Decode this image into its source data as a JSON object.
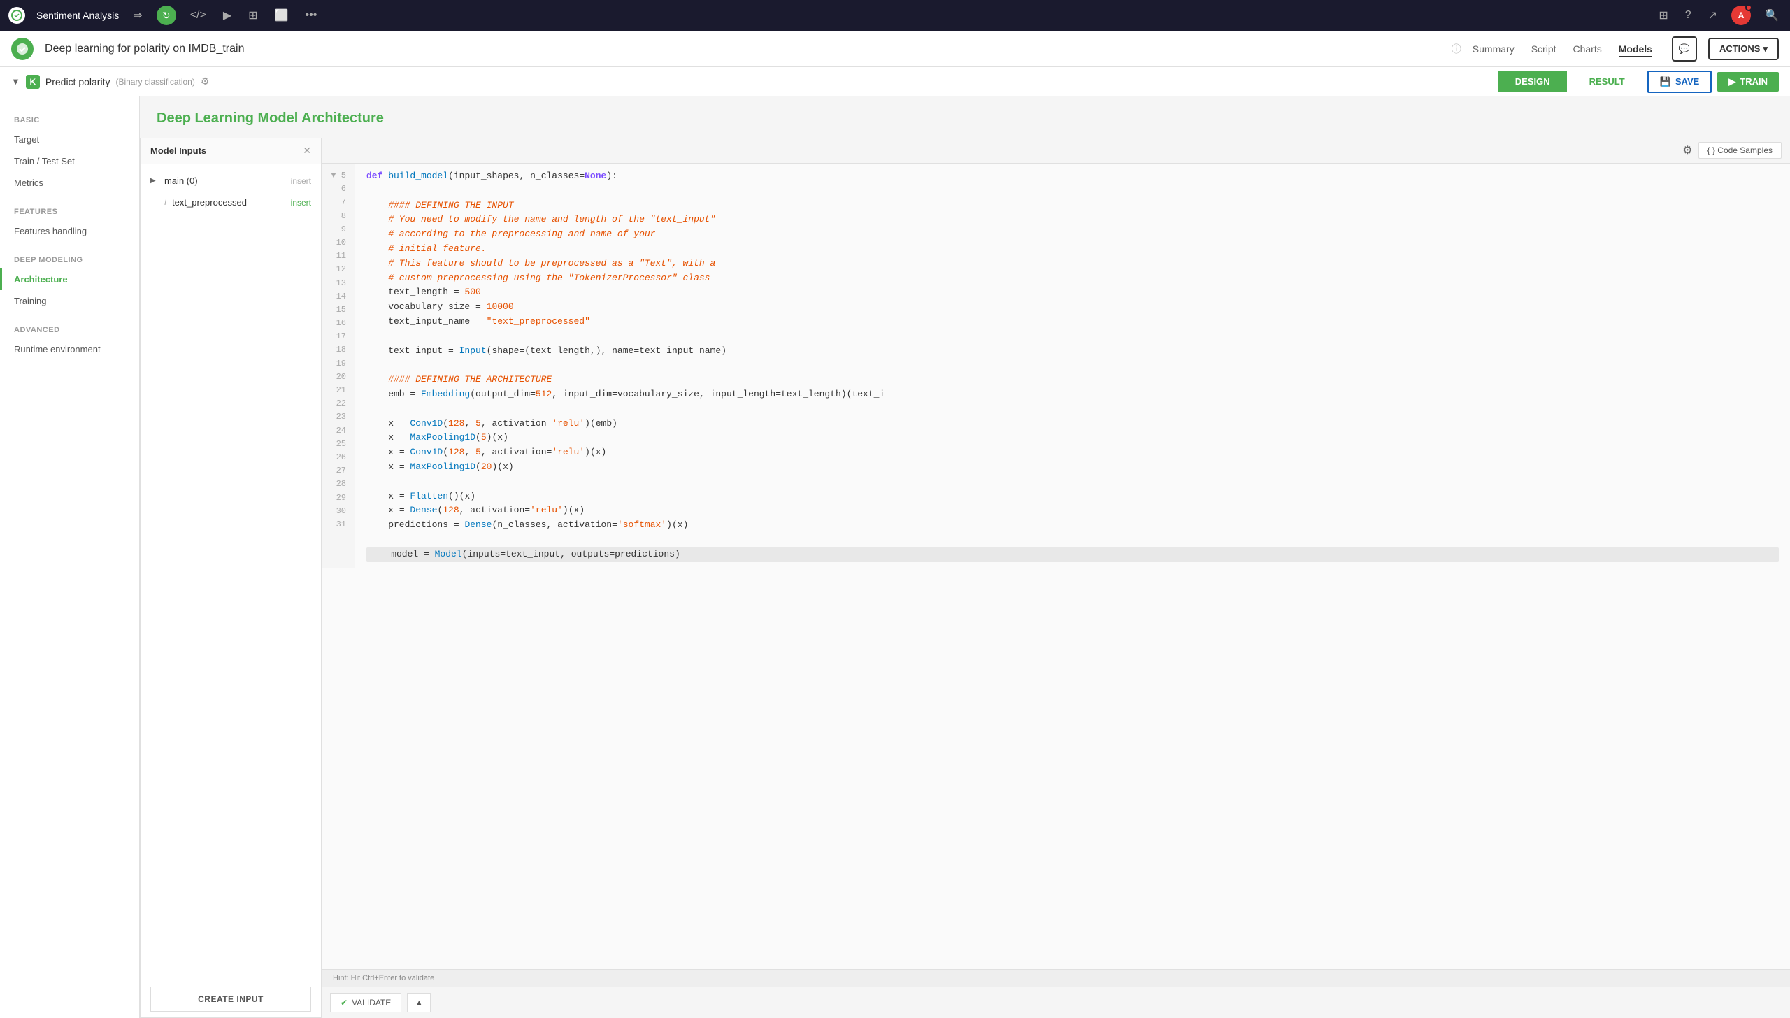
{
  "topNav": {
    "appName": "Sentiment Analysis",
    "icons": [
      "forward",
      "refresh",
      "code",
      "play",
      "grid",
      "copy",
      "more"
    ]
  },
  "subNav": {
    "projectName": "Deep learning for polarity on IMDB_train",
    "links": [
      {
        "label": "Summary",
        "active": false
      },
      {
        "label": "Script",
        "active": false
      },
      {
        "label": "Charts",
        "active": false
      },
      {
        "label": "Models",
        "active": true
      }
    ],
    "actionsLabel": "ACTIONS"
  },
  "breadcrumb": {
    "badge": "K",
    "name": "Predict polarity",
    "sub": "(Binary classification)",
    "designLabel": "DESIGN",
    "resultLabel": "RESULT",
    "saveLabel": "SAVE",
    "trainLabel": "TRAIN"
  },
  "sidebar": {
    "sections": [
      {
        "header": "BASIC",
        "items": [
          "Target",
          "Train / Test Set",
          "Metrics"
        ]
      },
      {
        "header": "FEATURES",
        "items": [
          "Features handling"
        ]
      },
      {
        "header": "DEEP MODELING",
        "items": [
          "Architecture",
          "Training"
        ]
      },
      {
        "header": "ADVANCED",
        "items": [
          "Runtime environment"
        ]
      }
    ],
    "activeItem": "Architecture"
  },
  "contentHeader": {
    "title": "Deep Learning Model Architecture"
  },
  "modelInputs": {
    "panelTitle": "Model Inputs",
    "inputs": [
      {
        "name": "main (0)",
        "insertLabel": "insert",
        "insertActive": false,
        "expanded": false
      },
      {
        "name": "text_preprocessed",
        "insertLabel": "insert",
        "insertActive": true,
        "isItalic": true
      }
    ],
    "createButtonLabel": "CREATE INPUT"
  },
  "codeEditor": {
    "codeSamplesLabel": "{ } Code Samples",
    "lines": [
      {
        "num": 5,
        "code": "def build_model(input_shapes, n_classes=None):",
        "type": "def"
      },
      {
        "num": 6,
        "code": "",
        "type": "blank"
      },
      {
        "num": 7,
        "code": "    #### DEFINING THE INPUT",
        "type": "comment-hash"
      },
      {
        "num": 8,
        "code": "    # You need to modify the name and length of the \"text_input\"",
        "type": "comment-hash"
      },
      {
        "num": 9,
        "code": "    # according to the preprocessing and name of your",
        "type": "comment-hash"
      },
      {
        "num": 10,
        "code": "    # initial feature.",
        "type": "comment-hash"
      },
      {
        "num": 11,
        "code": "    # This feature should to be preprocessed as a \"Text\", with a",
        "type": "comment-hash"
      },
      {
        "num": 12,
        "code": "    # custom preprocessing using the \"TokenizerProcessor\" class",
        "type": "comment-hash"
      },
      {
        "num": 13,
        "code": "    text_length = 500",
        "type": "assign"
      },
      {
        "num": 14,
        "code": "    vocabulary_size = 10000",
        "type": "assign"
      },
      {
        "num": 15,
        "code": "    text_input_name = \"text_preprocessed\"",
        "type": "assign-str"
      },
      {
        "num": 16,
        "code": "",
        "type": "blank"
      },
      {
        "num": 17,
        "code": "    text_input = Input(shape=(text_length,), name=text_input_name)",
        "type": "call"
      },
      {
        "num": 18,
        "code": "",
        "type": "blank"
      },
      {
        "num": 19,
        "code": "    #### DEFINING THE ARCHITECTURE",
        "type": "comment-hash"
      },
      {
        "num": 20,
        "code": "    emb = Embedding(output_dim=512, input_dim=vocabulary_size, input_length=text_length)(text_i",
        "type": "call-long"
      },
      {
        "num": 21,
        "code": "",
        "type": "blank"
      },
      {
        "num": 22,
        "code": "    x = Conv1D(128, 5, activation='relu')(emb)",
        "type": "call"
      },
      {
        "num": 23,
        "code": "    x = MaxPooling1D(5)(x)",
        "type": "call"
      },
      {
        "num": 24,
        "code": "    x = Conv1D(128, 5, activation='relu')(x)",
        "type": "call"
      },
      {
        "num": 25,
        "code": "    x = MaxPooling1D(20)(x)",
        "type": "call"
      },
      {
        "num": 26,
        "code": "",
        "type": "blank"
      },
      {
        "num": 27,
        "code": "    x = Flatten()(x)",
        "type": "call"
      },
      {
        "num": 28,
        "code": "    x = Dense(128, activation='relu')(x)",
        "type": "call"
      },
      {
        "num": 29,
        "code": "    predictions = Dense(n_classes, activation='softmax')(x)",
        "type": "call"
      },
      {
        "num": 30,
        "code": "",
        "type": "blank"
      },
      {
        "num": 31,
        "code": "    model = Model(inputs=text_input, outputs=predictions)",
        "type": "call-partial"
      }
    ],
    "hint": "Hint: Hit Ctrl+Enter to validate",
    "validateLabel": "VALIDATE",
    "expandLabel": "▲"
  }
}
